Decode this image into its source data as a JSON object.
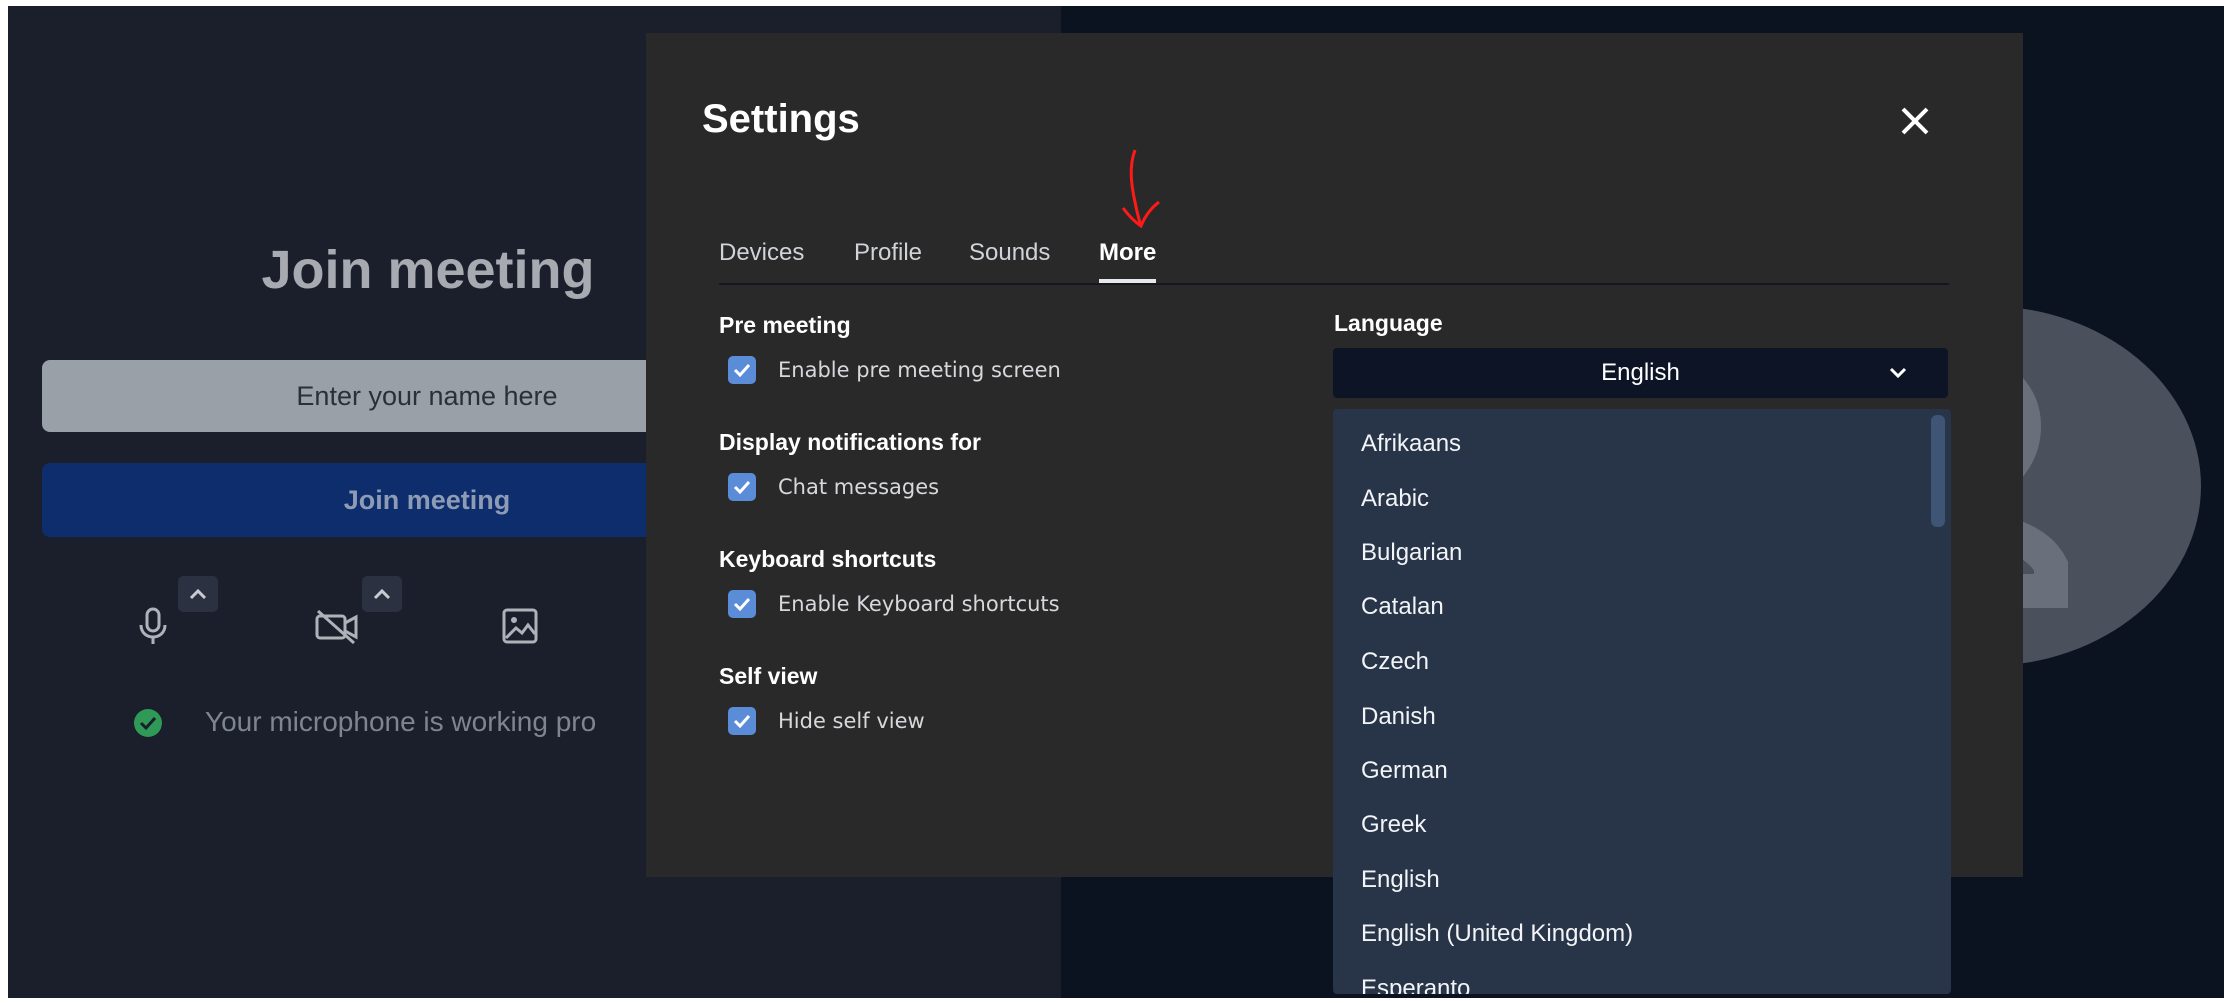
{
  "pre_meeting": {
    "title": "Join meeting",
    "name_placeholder": "Enter your name here",
    "join_button": "Join meeting",
    "mic_status": "Your microphone is working pro"
  },
  "icons": {
    "microphone": "microphone-icon",
    "camera_off": "camera-off-icon",
    "background": "image-icon",
    "caret": "chevron-up-icon",
    "check": "check-circle-icon",
    "close": "close-icon",
    "checkbox": "checkbox-checked-icon",
    "dropdown": "chevron-down-icon",
    "annotation": "red-arrow-annotation"
  },
  "settings": {
    "title": "Settings",
    "tabs": [
      {
        "label": "Devices",
        "active": false
      },
      {
        "label": "Profile",
        "active": false
      },
      {
        "label": "Sounds",
        "active": false
      },
      {
        "label": "More",
        "active": true
      }
    ],
    "sections": [
      {
        "heading": "Pre meeting",
        "option": "Enable pre meeting screen",
        "checked": true
      },
      {
        "heading": "Display notifications for",
        "option": "Chat messages",
        "checked": true
      },
      {
        "heading": "Keyboard shortcuts",
        "option": "Enable Keyboard shortcuts",
        "checked": true
      },
      {
        "heading": "Self view",
        "option": "Hide self view",
        "checked": true
      }
    ],
    "language": {
      "heading": "Language",
      "selected": "English",
      "options": [
        "Afrikaans",
        "Arabic",
        "Bulgarian",
        "Catalan",
        "Czech",
        "Danish",
        "German",
        "Greek",
        "English",
        "English (United Kingdom)",
        "Esperanto"
      ]
    }
  },
  "colors": {
    "modal_bg": "#292929",
    "checkbox": "#5b8cd8",
    "dropdown_bg": "#283548",
    "select_bg": "#0c1426",
    "annotation": "#ff0000"
  }
}
